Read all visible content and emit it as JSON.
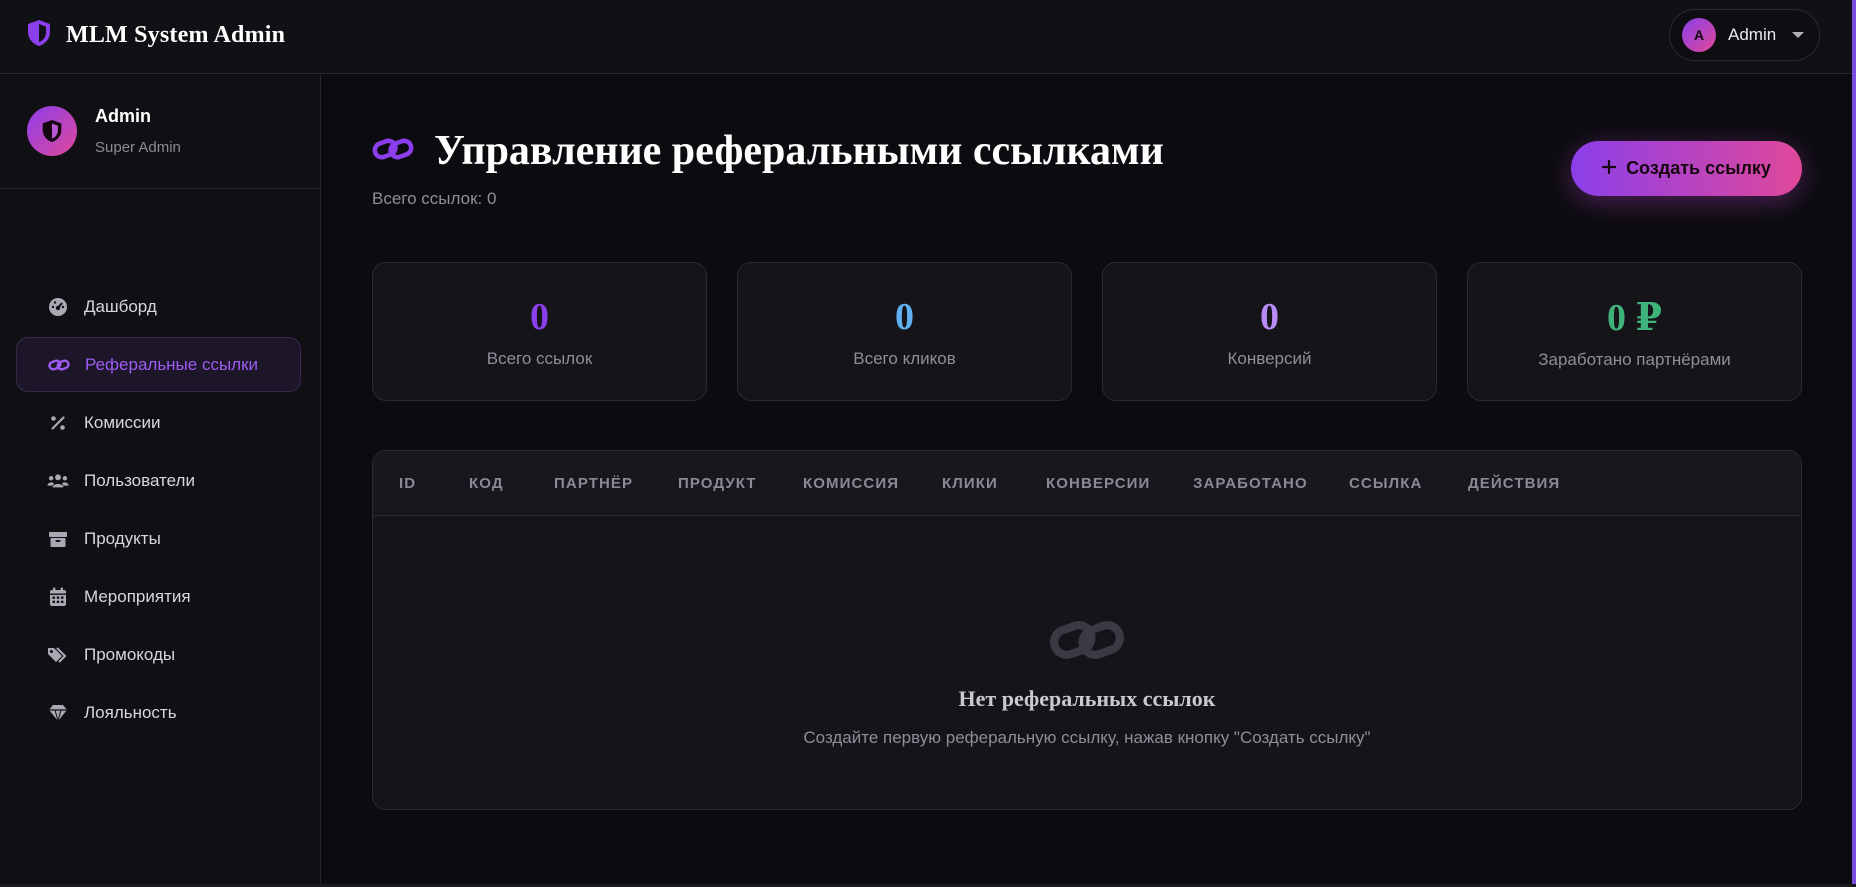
{
  "app": {
    "title": "MLM System Admin",
    "brand_icon": "shield-icon",
    "accent": "#9b5cf2",
    "gradient_start": "#8b3fea",
    "gradient_end": "#e0489a"
  },
  "header": {
    "user": {
      "initial": "A",
      "name": "Admin"
    }
  },
  "sidebar": {
    "profile": {
      "name": "Admin",
      "role": "Super Admin",
      "icon": "shield-icon"
    },
    "items": [
      {
        "label": "Дашборд",
        "icon": "gauge-icon",
        "active": false
      },
      {
        "label": "Реферальные ссылки",
        "icon": "link-icon",
        "active": true
      },
      {
        "label": "Комиссии",
        "icon": "percent-icon",
        "active": false
      },
      {
        "label": "Пользователи",
        "icon": "users-icon",
        "active": false
      },
      {
        "label": "Продукты",
        "icon": "box-icon",
        "active": false
      },
      {
        "label": "Мероприятия",
        "icon": "calendar-icon",
        "active": false
      },
      {
        "label": "Промокоды",
        "icon": "tags-icon",
        "active": false
      },
      {
        "label": "Лояльность",
        "icon": "gem-icon",
        "active": false
      }
    ]
  },
  "page": {
    "title": "Управление реферальными ссылками",
    "subtitle": "Всего ссылок: 0",
    "create_button": "Создать ссылку"
  },
  "stats": [
    {
      "value": "0",
      "label": "Всего ссылок",
      "color": "#8b3fea"
    },
    {
      "value": "0",
      "label": "Всего кликов",
      "color": "#5fb0f0"
    },
    {
      "value": "0",
      "label": "Конверсий",
      "color": "#b88cf5"
    },
    {
      "value": "0 ₽",
      "label": "Заработано партнёрами",
      "color": "#3fb47a"
    }
  ],
  "table": {
    "columns": [
      "ID",
      "КОД",
      "ПАРТНЁР",
      "ПРОДУКТ",
      "КОМИССИЯ",
      "КЛИКИ",
      "КОНВЕРСИИ",
      "ЗАРАБОТАНО",
      "ССЫЛКА",
      "ДЕЙСТВИЯ"
    ],
    "rows": [],
    "empty": {
      "icon": "link-icon",
      "title": "Нет реферальных ссылок",
      "text": "Создайте первую реферальную ссылку, нажав кнопку \"Создать ссылку\""
    }
  }
}
